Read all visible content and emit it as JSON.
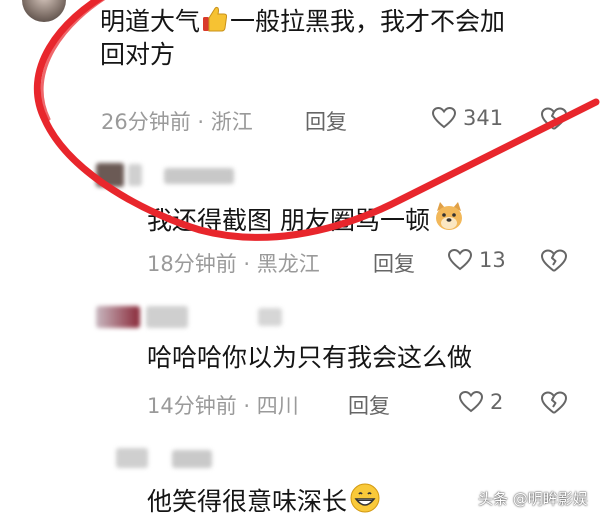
{
  "comments": [
    {
      "text_line1": "明道大气",
      "text_line1_after": "一般拉黑我，我才不会加",
      "text_line2": "回对方",
      "time": "26分钟前",
      "sep": "·",
      "location": "浙江",
      "reply_label": "回复",
      "likes": "341",
      "emoji": "thumbs-up"
    },
    {
      "text": "我还得截图 朋友圈骂一顿",
      "time": "18分钟前",
      "sep": "·",
      "location": "黑龙江",
      "reply_label": "回复",
      "likes": "13",
      "emoji": "doge-face"
    },
    {
      "text": "哈哈哈你以为只有我会这么做",
      "time": "14分钟前",
      "sep": "·",
      "location": "四川",
      "reply_label": "回复",
      "likes": "2"
    },
    {
      "text": "他笑得很意味深长",
      "emoji": "grinning-face"
    }
  ],
  "watermark": "头条 @明眸影娱",
  "colors": {
    "annotation_stroke": "#e8262c",
    "meta_text": "#9a9a9a",
    "body_text": "#151515"
  }
}
